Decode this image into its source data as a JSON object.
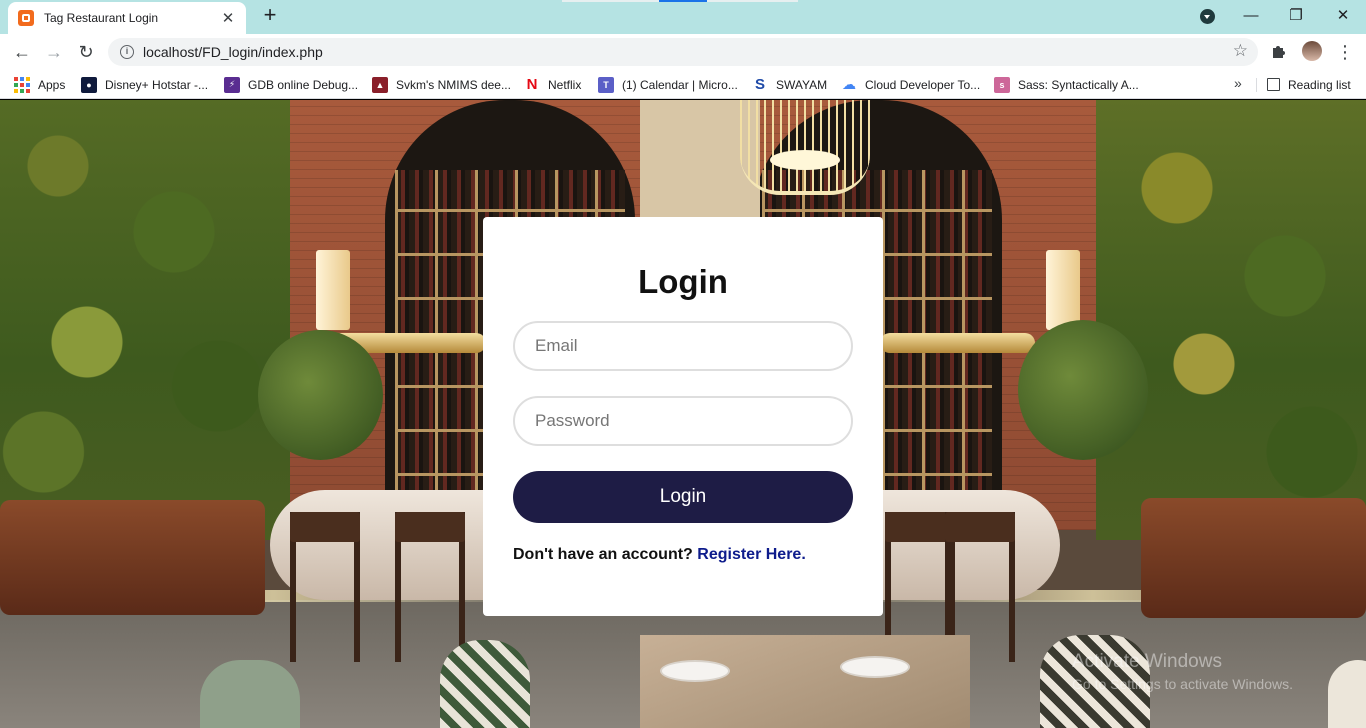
{
  "browser": {
    "tab": {
      "title": "Tag Restaurant Login",
      "close_glyph": "✕"
    },
    "new_tab_glyph": "+",
    "window_controls": {
      "minimize": "—",
      "maximize": "❐",
      "close": "✕"
    },
    "nav": {
      "back": "←",
      "forward": "→",
      "reload": "↻",
      "menu": "⋮"
    },
    "address": {
      "info_glyph": "i",
      "url": "localhost/FD_login/index.php",
      "star": "☆"
    },
    "bookmarks": [
      {
        "label": "Apps",
        "icon": "apps-grid-icon"
      },
      {
        "label": "Disney+ Hotstar -...",
        "icon": "hotstar-icon",
        "color": "#0f1a3c"
      },
      {
        "label": "GDB online Debug...",
        "icon": "gdb-icon",
        "color": "#5a2d91"
      },
      {
        "label": "Svkm's NMIMS dee...",
        "icon": "nmims-icon",
        "color": "#8a1f2a"
      },
      {
        "label": "Netflix",
        "icon": "netflix-icon",
        "color": "#e50914"
      },
      {
        "label": "(1) Calendar | Micro...",
        "icon": "teams-icon",
        "color": "#5b5fc7"
      },
      {
        "label": "SWAYAM",
        "icon": "swayam-icon",
        "color": "#1f4aa8"
      },
      {
        "label": "Cloud Developer To...",
        "icon": "google-cloud-icon",
        "color": "#4285f4"
      },
      {
        "label": "Sass: Syntactically A...",
        "icon": "sass-icon",
        "color": "#cd6799"
      }
    ],
    "bookmarks_overflow": "»",
    "reading_list": "Reading list"
  },
  "login": {
    "title": "Login",
    "email_placeholder": "Email",
    "password_placeholder": "Password",
    "button_label": "Login",
    "register_prompt": "Don't have an account?",
    "register_link": "Register Here.",
    "accent_color": "#1e1c45"
  },
  "watermark": {
    "title": "Activate Windows",
    "subtitle": "Go to Settings to activate Windows."
  }
}
